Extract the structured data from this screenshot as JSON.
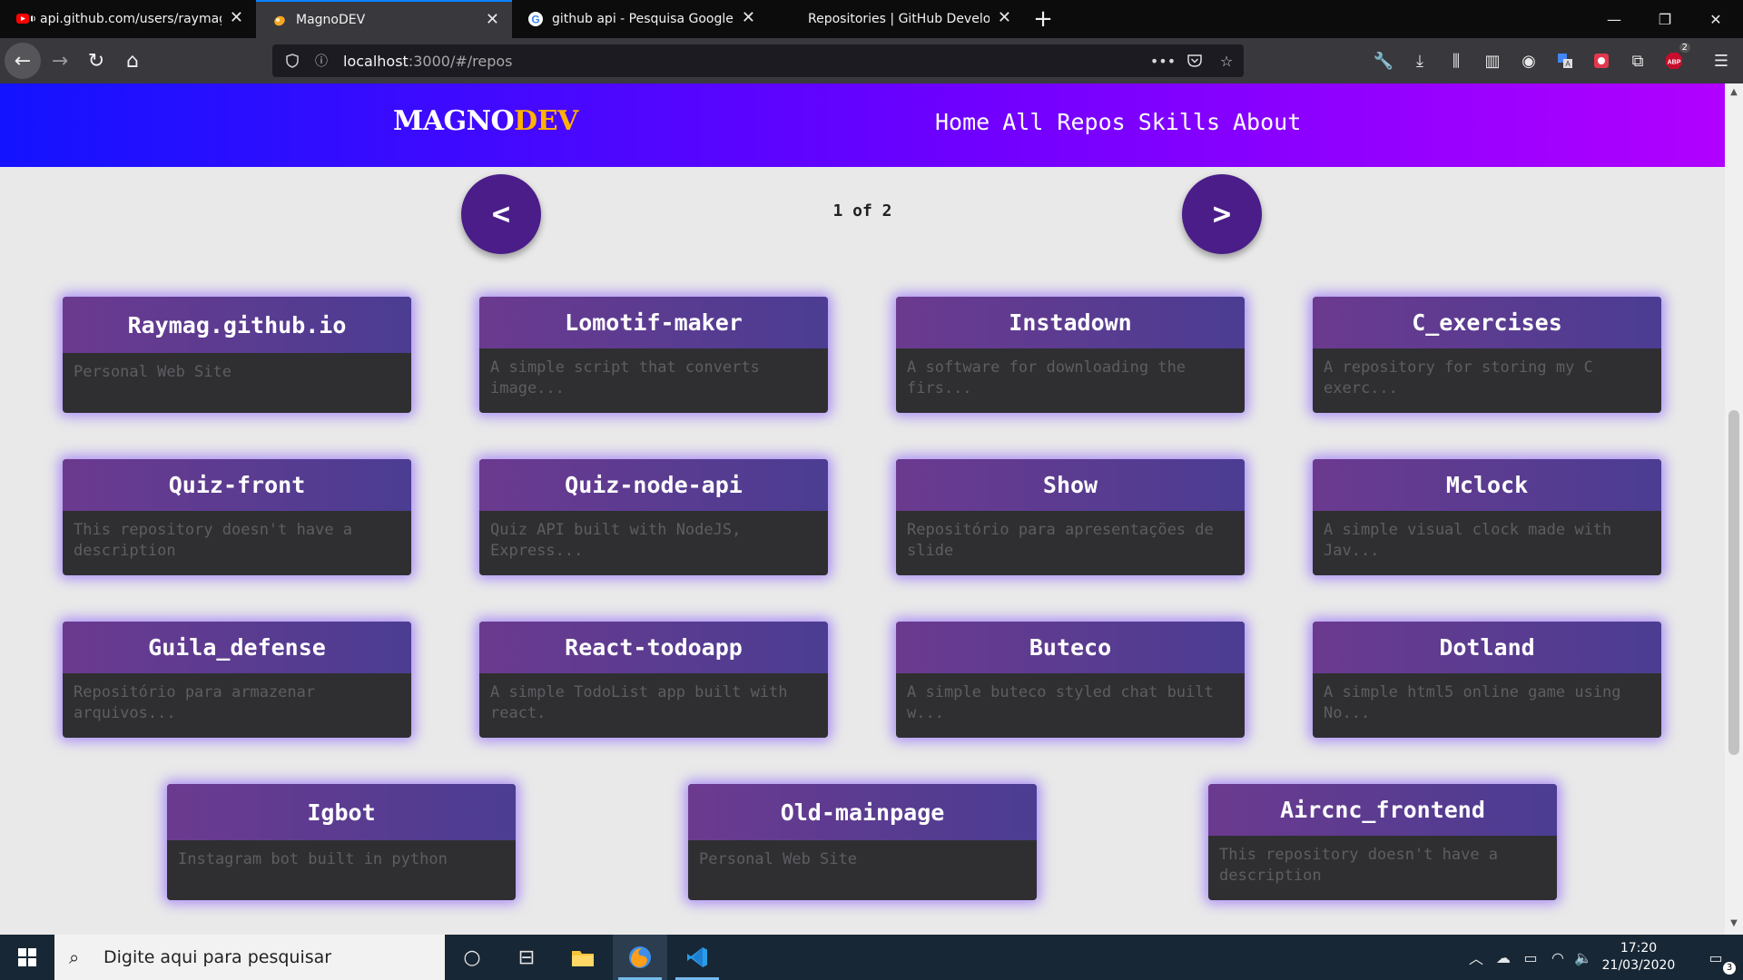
{
  "browser": {
    "tabs": [
      {
        "label": "api.github.com/users/raymag/repos",
        "favicon": "youtube-icon",
        "active": false
      },
      {
        "label": "MagnoDEV",
        "favicon": "site-icon",
        "active": true
      },
      {
        "label": "github api - Pesquisa Google",
        "favicon": "google-icon",
        "active": false
      },
      {
        "label": "Repositories | GitHub Developer Guide",
        "favicon": "none",
        "active": false
      }
    ],
    "url_host": "localhost",
    "url_path": ":3000/#/repos",
    "extension_badge": "2"
  },
  "site": {
    "logo_main": "MAGNO",
    "logo_accent": "DEV",
    "nav": [
      "Home",
      "All Repos",
      "Skills",
      "About"
    ],
    "pager": {
      "prev": "<",
      "next": ">",
      "info": "1 of 2"
    }
  },
  "repos": [
    {
      "name": "Raymag.github.io",
      "desc": "Personal Web Site"
    },
    {
      "name": "Lomotif-maker",
      "desc": "A simple script that converts image..."
    },
    {
      "name": "Instadown",
      "desc": "A software for downloading the firs..."
    },
    {
      "name": "C_exercises",
      "desc": "A repository for storing my C exerc..."
    },
    {
      "name": "Quiz-front",
      "desc": "This repository doesn't have a description"
    },
    {
      "name": "Quiz-node-api",
      "desc": "Quiz API built with NodeJS, Express..."
    },
    {
      "name": "Show",
      "desc": "Repositório para apresentações de slide"
    },
    {
      "name": "Mclock",
      "desc": "A simple visual clock made with Jav..."
    },
    {
      "name": "Guila_defense",
      "desc": "Repositório para armazenar arquivos..."
    },
    {
      "name": "React-todoapp",
      "desc": "A simple TodoList app built with react."
    },
    {
      "name": "Buteco",
      "desc": "A simple buteco styled chat built w..."
    },
    {
      "name": "Dotland",
      "desc": "A simple html5 online game using No..."
    },
    {
      "name": "Igbot",
      "desc": "Instagram bot built in python"
    },
    {
      "name": "Old-mainpage",
      "desc": "Personal Web Site"
    },
    {
      "name": "Aircnc_frontend",
      "desc": "This repository doesn't have a description"
    }
  ],
  "taskbar": {
    "search_placeholder": "Digite aqui para pesquisar",
    "time": "17:20",
    "date": "21/03/2020",
    "notifications": "3"
  },
  "colors": {
    "header_start": "#1313ff",
    "header_end": "#b100ff",
    "logo_accent": "#ffb100",
    "pager_button": "#4a1d88",
    "card_glow": "#7846ff",
    "card_body": "#2f2f32"
  }
}
